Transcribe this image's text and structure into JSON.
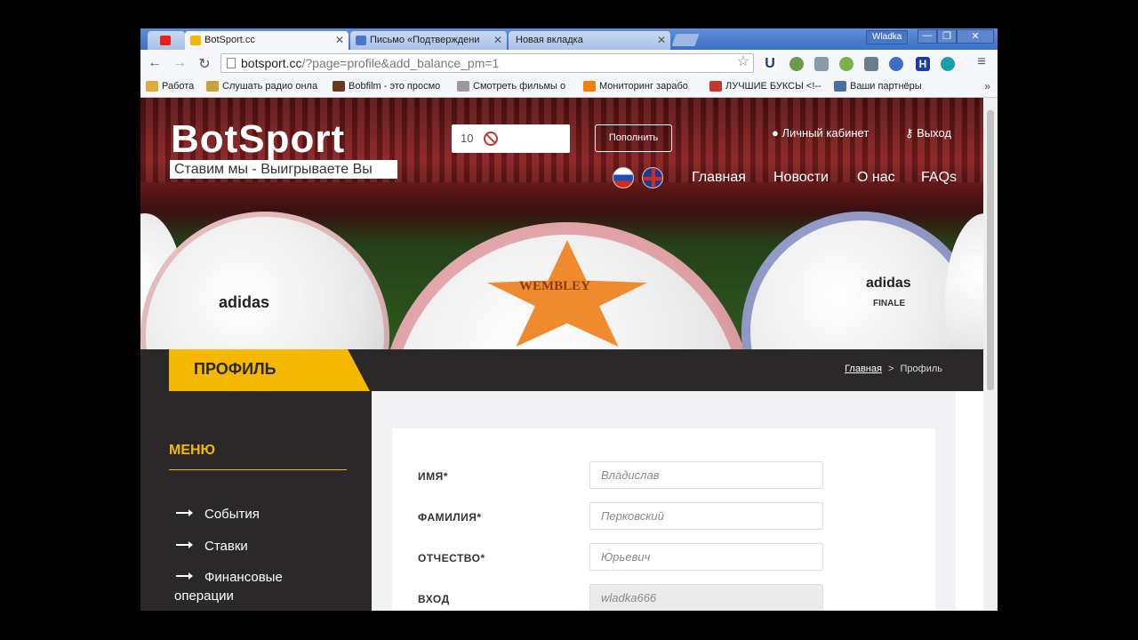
{
  "browser": {
    "tabs": [
      {
        "label": "",
        "favicon": "youtube-icon",
        "color": "#e62117"
      },
      {
        "label": "BotSport.cc",
        "favicon": "bs-icon",
        "color": "#f5b800"
      },
      {
        "label": "Письмо «Подтверждени",
        "favicon": "mail-icon",
        "color": "#4a76c4"
      },
      {
        "label": "Новая вкладка",
        "favicon": "",
        "color": ""
      }
    ],
    "window_user": "Wladka",
    "window_buttons": [
      "—",
      "❐",
      "✕"
    ],
    "url_host": "botsport.cc",
    "url_path": "/?page=profile&add_balance_pm=1",
    "bookmarks": [
      {
        "label": "Работа",
        "icon": "folder-icon",
        "color": "#e0a93a"
      },
      {
        "label": "Слушать радио онла",
        "icon": "radio-icon",
        "color": "#c9a23c"
      },
      {
        "label": "Bobfilm - это просмо",
        "icon": "bobfilm-icon",
        "color": "#6b3a1a"
      },
      {
        "label": "Смотреть фильмы о",
        "icon": "hd-icon",
        "color": "#999999"
      },
      {
        "label": "Мониторинг зарабо",
        "icon": "blogger-icon",
        "color": "#f57d00"
      },
      {
        "label": "ЛУЧШИЕ БУКСЫ <!--",
        "icon": "bux-icon",
        "color": "#c0392b"
      },
      {
        "label": "Ваши партнёры",
        "icon": "partners-icon",
        "color": "#4a6fa5"
      }
    ],
    "bookmarks_more": "»"
  },
  "site": {
    "logo_title": "BotSport",
    "logo_tagline": "Ставим мы - Выигрываете Вы",
    "balance_value": "10",
    "topup_label": "Пополнить",
    "account_link": "Личный кабинет",
    "logout_link": "Выход",
    "nav": [
      "Главная",
      "Новости",
      "О нас",
      "FAQs"
    ],
    "page_title": "ПРОФИЛЬ",
    "breadcrumb_home": "Главная",
    "breadcrumb_sep": ">",
    "breadcrumb_current": "Профиль",
    "ball_texts": [
      "adidas",
      "WEMBLEY",
      "adidas",
      "FINALE"
    ]
  },
  "menu": {
    "title": "МЕНЮ",
    "items": [
      "События",
      "Ставки",
      "Финансовые операции"
    ]
  },
  "form": {
    "fields": [
      {
        "label": "ИМЯ*",
        "value": "Владислав"
      },
      {
        "label": "ФАМИЛИЯ*",
        "value": "Перковский"
      },
      {
        "label": "ОТЧЕСТВО*",
        "value": "Юрьевич"
      },
      {
        "label": "ВХОД",
        "value": "wladka666"
      }
    ]
  },
  "colors": {
    "accent": "#f5b800",
    "dark": "#2a2828"
  }
}
